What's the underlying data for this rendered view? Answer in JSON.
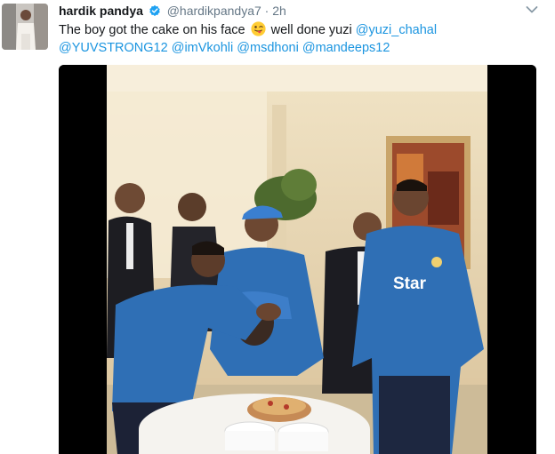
{
  "tweet": {
    "author_name": "hardik pandya",
    "handle": "@hardikpandya7",
    "separator": "·",
    "time": "2h",
    "text_part1": "The boy got the cake on his face",
    "emoji": "winking-tongue-face",
    "text_part2": "well done yuzi",
    "mentions": [
      "@yuzi_chahal",
      "@YUVSTRONG12",
      "@imVkohli",
      "@msdhoni",
      "@mandeeps12"
    ]
  },
  "video": {
    "jersey_text": "Star"
  },
  "colors": {
    "link": "#1b95e0",
    "verified": "#1da1f2",
    "jersey_blue": "#2f6fb5",
    "text_secondary": "#657786"
  }
}
